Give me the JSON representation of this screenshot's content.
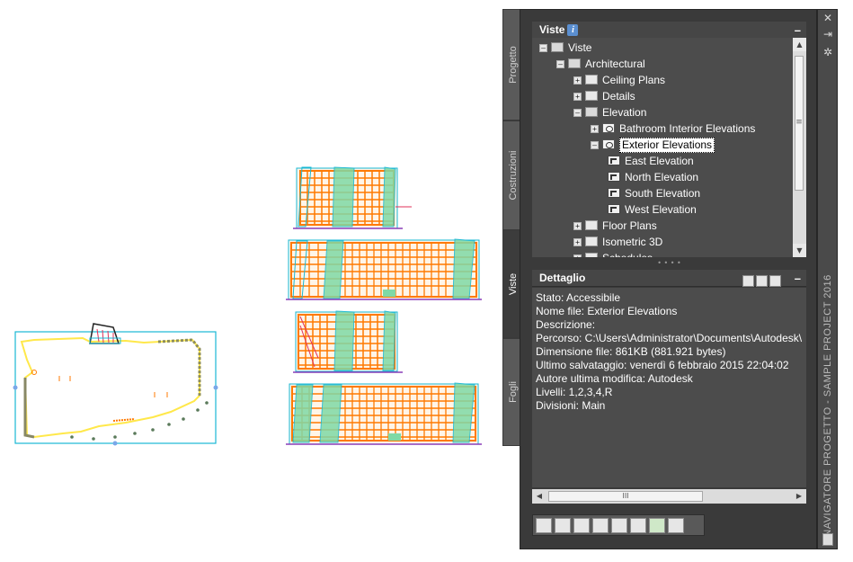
{
  "tabs": [
    {
      "label": "Progetto",
      "active": false
    },
    {
      "label": "Costruzioni",
      "active": false
    },
    {
      "label": "Viste",
      "active": true
    },
    {
      "label": "Fogli",
      "active": false
    }
  ],
  "palette_title": "NAVIGATORE PROGETTO - SAMPLE PROJECT 2016",
  "strip_buttons": {
    "close": "✕",
    "pin": "⇥",
    "settings": "✲"
  },
  "views_panel": {
    "title": "Viste",
    "info_badge": "i",
    "collapse": "–",
    "tree": [
      {
        "label": "Viste",
        "level": 0,
        "toggle": "–",
        "icon": "folder-open-icon"
      },
      {
        "label": "Architectural",
        "level": 1,
        "toggle": "–",
        "icon": "folder-open-icon"
      },
      {
        "label": "Ceiling Plans",
        "level": 2,
        "toggle": "+",
        "icon": "folder-icon"
      },
      {
        "label": "Details",
        "level": 2,
        "toggle": "+",
        "icon": "folder-icon"
      },
      {
        "label": "Elevation",
        "level": 2,
        "toggle": "–",
        "icon": "folder-open-icon"
      },
      {
        "label": "Bathroom Interior Elevations",
        "level": 3,
        "toggle": "+",
        "icon": "elevation-group-icon"
      },
      {
        "label": "Exterior Elevations",
        "level": 3,
        "toggle": "–",
        "icon": "elevation-group-icon",
        "selected": true
      },
      {
        "label": "East Elevation",
        "level": 4,
        "toggle": "",
        "icon": "view-icon"
      },
      {
        "label": "North Elevation",
        "level": 4,
        "toggle": "",
        "icon": "view-icon"
      },
      {
        "label": "South Elevation",
        "level": 4,
        "toggle": "",
        "icon": "view-icon"
      },
      {
        "label": "West Elevation",
        "level": 4,
        "toggle": "",
        "icon": "view-icon"
      },
      {
        "label": "Floor Plans",
        "level": 2,
        "toggle": "+",
        "icon": "folder-icon"
      },
      {
        "label": "Isometric 3D",
        "level": 2,
        "toggle": "+",
        "icon": "folder-icon"
      },
      {
        "label": "Schedules",
        "level": 2,
        "toggle": "+",
        "icon": "folder-icon"
      }
    ]
  },
  "details_panel": {
    "title": "Dettaglio",
    "collapse": "–",
    "lines": [
      "Stato: Accessibile",
      "Nome file: Exterior Elevations",
      "Descrizione:",
      "Percorso: C:\\Users\\Administrator\\Documents\\Autodesk\\",
      "Dimensione file: 861KB (881.921 bytes)",
      "Ultimo salvataggio: venerdì 6 febbraio 2015  22:04:02",
      "Autore ultima modifica: Autodesk",
      "Livelli: 1,2,3,4,R",
      "Divisioni: Main"
    ]
  },
  "scrollbar": {
    "up": "▲",
    "down": "▼",
    "left": "◀",
    "right": "▶",
    "grip": "III",
    "vgrip": "≡"
  },
  "toolbar": [
    "new-view-icon",
    "new-section-icon",
    "new-detail-icon",
    "clipboard-icon",
    "pointer-icon",
    "schedule-icon",
    "refresh-icon",
    "delete-icon"
  ],
  "colors": {
    "panel_bg": "#3a3a3a",
    "list_bg": "#4c4c4c",
    "orange": "#ff7a00",
    "cyan": "#19b8d4",
    "green": "#7fd9a6",
    "yellow": "#ffe84a"
  }
}
